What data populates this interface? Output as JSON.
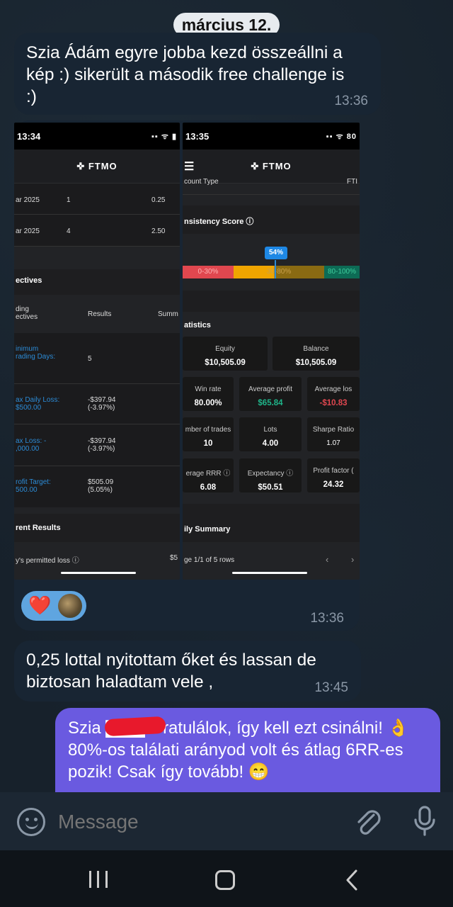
{
  "date_chip": "március 12.",
  "messages": [
    {
      "text": "Szia Ádám egyre jobba kezd összeállni a kép :) sikerült a második free challenge is :)",
      "time": "13:36"
    },
    {
      "time": "13:36"
    },
    {
      "text": "0,25 lottal nyitottam őket és lassan de biztosan haladtam vele ,",
      "time": "13:45"
    },
    {
      "text": "Szia ▇▇▇ Gratulálok, így kell ezt csinálni! 👌 80%-os találati arányod volt és átlag 6RR-es pozik! Csak így tovább! 😁"
    }
  ],
  "reactions": {
    "emoji": "❤️"
  },
  "input": {
    "placeholder": "Message"
  },
  "shot_left": {
    "status_time": "13:34",
    "status_icons": "▪▪ ᯤ ▮",
    "logo": "✜ FTMO",
    "rows": [
      [
        "ar 2025",
        "1",
        "0.25"
      ],
      [
        "ar 2025",
        "4",
        "2.50"
      ]
    ],
    "objectives_title": "ectives",
    "col_a": "ding\nectives",
    "col_b": "Results",
    "col_c": "Summ",
    "objectives": [
      {
        "label": "inimum\nrading Days:",
        "value": "5"
      },
      {
        "label": "ax Daily Loss:\n$500.00",
        "value": "-$397.94\n(-3.97%)"
      },
      {
        "label": "ax Loss: -\n,000.00",
        "value": "-$397.94\n(-3.97%)"
      },
      {
        "label": "rofit Target:\n500.00",
        "value": "$505.09\n(5.05%)"
      }
    ],
    "current_results": "rent Results",
    "permitted_loss": "y's permitted loss ⓘ",
    "permitted_val": "$5"
  },
  "shot_right": {
    "status_time": "13:35",
    "status_icons": "▪▪ ᯤ 80",
    "logo": "✜ FTMO",
    "menu": "☰",
    "account_type": "count Type",
    "account_type_val": "FTI",
    "consistency": "nsistency Score ⓘ",
    "score": "54%",
    "segments": [
      "0-30%",
      "30-80%",
      "80-100%"
    ],
    "statistics": "atistics",
    "equity_label": "Equity",
    "equity": "$10,505.09",
    "balance_label": "Balance",
    "balance": "$10,505.09",
    "stats": [
      {
        "k": "Win rate",
        "v": "80.00%"
      },
      {
        "k": "Average profit",
        "v": "$65.84"
      },
      {
        "k": "Average los",
        "v": "-$10.83"
      },
      {
        "k": "mber of trades",
        "v": "10"
      },
      {
        "k": "Lots",
        "v": "4.00"
      },
      {
        "k": "Sharpe Ratio",
        "v": "1.07"
      },
      {
        "k": "erage RRR ⓘ",
        "v": "6.08"
      },
      {
        "k": "Expectancy ⓘ",
        "v": "$50.51"
      },
      {
        "k": "Profit factor (",
        "v": "24.32"
      }
    ],
    "daily_summary": "ily Summary",
    "pager": "ge 1/1 of 5 rows"
  },
  "colors": {
    "bubble_in": "#182533",
    "bubble_out": "#6a5ae0",
    "green": "#1fb58a",
    "red": "#e0474f",
    "accent_blue": "#2c8bd6"
  }
}
